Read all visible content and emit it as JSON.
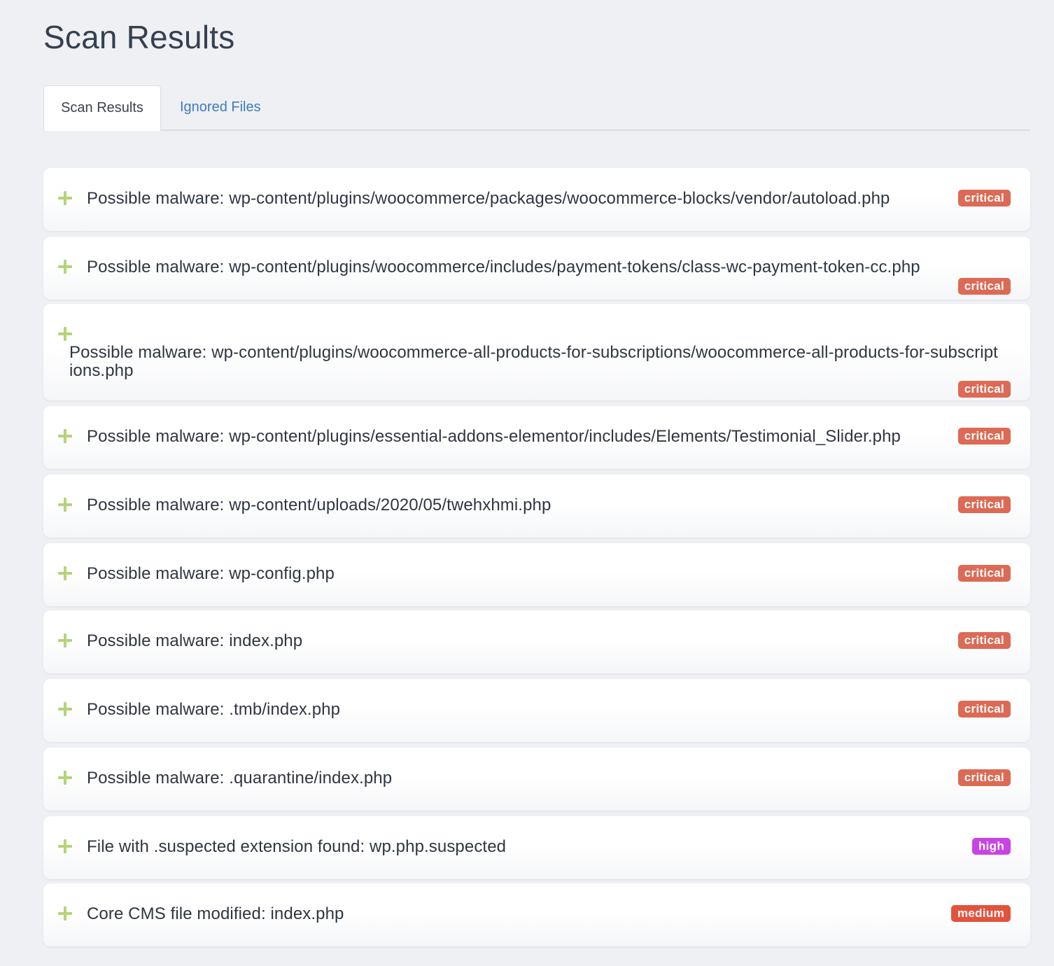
{
  "page": {
    "title": "Scan Results"
  },
  "tabs": [
    {
      "label": "Scan Results",
      "active": true
    },
    {
      "label": "Ignored Files",
      "active": false
    }
  ],
  "expand_icon": "plus-icon",
  "colors": {
    "critical": "#dc6a55",
    "high": "#c842e6",
    "medium": "#e3533c",
    "expand_icon": "#b5d37a",
    "link": "#3e7bbf"
  },
  "results": [
    {
      "text": "Possible malware: wp-content/plugins/woocommerce/packages/woocommerce-blocks/vendor/autoload.php",
      "severity": "critical"
    },
    {
      "text": "Possible malware: wp-content/plugins/woocommerce/includes/payment-tokens/class-wc-payment-token-cc.php",
      "severity": "critical"
    },
    {
      "text": "Possible malware: wp-content/plugins/woocommerce-all-products-for-subscriptions/woocommerce-all-products-for-subscriptions.php",
      "severity": "critical"
    },
    {
      "text": "Possible malware: wp-content/plugins/essential-addons-elementor/includes/Elements/Testimonial_Slider.php",
      "severity": "critical"
    },
    {
      "text": "Possible malware: wp-content/uploads/2020/05/twehxhmi.php",
      "severity": "critical"
    },
    {
      "text": "Possible malware: wp-config.php",
      "severity": "critical"
    },
    {
      "text": "Possible malware: index.php",
      "severity": "critical"
    },
    {
      "text": "Possible malware: .tmb/index.php",
      "severity": "critical"
    },
    {
      "text": "Possible malware: .quarantine/index.php",
      "severity": "critical"
    },
    {
      "text": "File with .suspected extension found: wp.php.suspected",
      "severity": "high"
    },
    {
      "text": "Core CMS file modified: index.php",
      "severity": "medium"
    }
  ]
}
